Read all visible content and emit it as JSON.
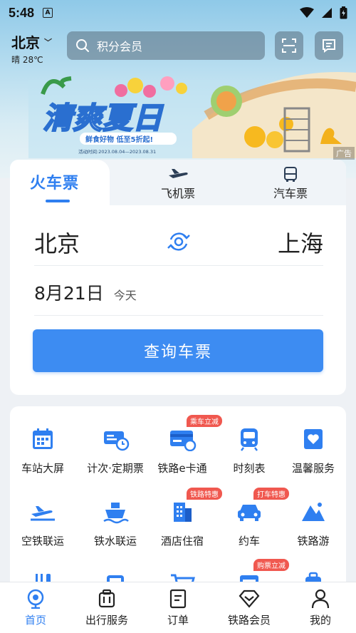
{
  "status_bar": {
    "time": "5:48"
  },
  "header": {
    "city": "北京",
    "weather": "晴 28℃",
    "search_placeholder": "积分会员"
  },
  "banner": {
    "title": "清爽夏日",
    "subtitle": "鲜食好物  低至5折起!",
    "period": "活动时间:2023.08.04—2023.08.31",
    "ad_label": "广告"
  },
  "ticket": {
    "tabs": [
      {
        "label": "火车票",
        "icon": "train-icon"
      },
      {
        "label": "飞机票",
        "icon": "plane-icon"
      },
      {
        "label": "汽车票",
        "icon": "bus-icon"
      }
    ],
    "from": "北京",
    "to": "上海",
    "date": "8月21日",
    "weekday": "今天",
    "query_label": "查询车票"
  },
  "services": [
    {
      "label": "车站大屏",
      "icon": "calendar-icon",
      "tag": ""
    },
    {
      "label": "计次·定期票",
      "icon": "ticket-clock-icon",
      "tag": ""
    },
    {
      "label": "铁路e卡通",
      "icon": "card-icon",
      "tag": "乘车立减"
    },
    {
      "label": "时刻表",
      "icon": "train-front-icon",
      "tag": ""
    },
    {
      "label": "温馨服务",
      "icon": "heart-icon",
      "tag": ""
    },
    {
      "label": "空铁联运",
      "icon": "plane-rail-icon",
      "tag": ""
    },
    {
      "label": "铁水联运",
      "icon": "ship-icon",
      "tag": ""
    },
    {
      "label": "酒店住宿",
      "icon": "hotel-icon",
      "tag": "铁路特惠"
    },
    {
      "label": "约车",
      "icon": "car-icon",
      "tag": "打车特惠"
    },
    {
      "label": "铁路游",
      "icon": "mountain-icon",
      "tag": ""
    },
    {
      "label": "",
      "icon": "food-icon",
      "tag": ""
    },
    {
      "label": "",
      "icon": "bus-service-icon",
      "tag": ""
    },
    {
      "label": "",
      "icon": "cart-icon",
      "tag": ""
    },
    {
      "label": "",
      "icon": "coupon-icon",
      "tag": "购票立减"
    },
    {
      "label": "",
      "icon": "luggage-icon",
      "tag": ""
    }
  ],
  "bottom_nav": [
    {
      "label": "首页",
      "icon": "home-icon",
      "active": true
    },
    {
      "label": "出行服务",
      "icon": "luggage-icon",
      "active": false
    },
    {
      "label": "订单",
      "icon": "order-icon",
      "active": false
    },
    {
      "label": "铁路会员",
      "icon": "diamond-icon",
      "active": false
    },
    {
      "label": "我的",
      "icon": "profile-icon",
      "active": false
    }
  ],
  "colors": {
    "accent": "#2f7ff0",
    "button": "#3d8cf2",
    "tag": "#f0584f"
  }
}
